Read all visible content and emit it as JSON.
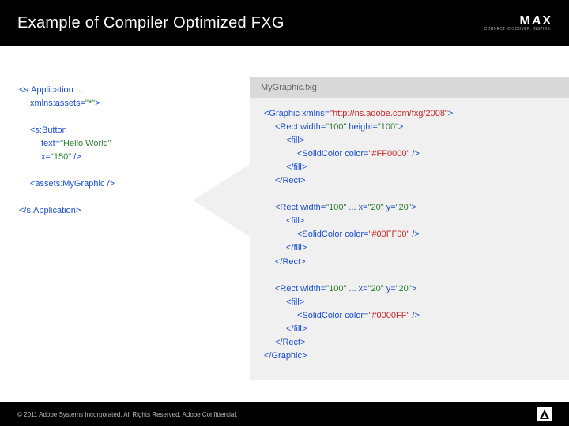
{
  "header": {
    "title": "Example of Compiler Optimized FXG",
    "logo_text": "MAX",
    "logo_tagline": "CONNECT. DISCOVER. INSPIRE."
  },
  "left": {
    "app_open": "<s:Application ...",
    "xmlns": "xmlns:assets=",
    "xmlns_val": "\"*\"",
    "xmlns_close": ">",
    "button_open": "<s:Button",
    "text_attr": "text=",
    "text_val": "\"Hello World\"",
    "x_attr": "x=",
    "x_val": "\"150\"",
    "button_close": " />",
    "mygraphic": "<assets:MyGraphic />",
    "app_close": "</s:Application>"
  },
  "right": {
    "filename": "MyGraphic.fxg:",
    "graphic_open": "<Graphic xmlns=",
    "graphic_ns": "\"http://ns.adobe.com/fxg/2008\"",
    "graphic_close": ">",
    "rect1_open": "<Rect width=",
    "rect1_w": "\"100\"",
    "rect1_mid": " height=",
    "rect1_h": "\"100\"",
    "rect1_end": ">",
    "fill_open": "<fill>",
    "solid_open": "<SolidColor color=",
    "color1": "\"#FF0000\"",
    "solid_close": " />",
    "fill_close": "</fill>",
    "rect_close": "</Rect>",
    "rect2_open": "<Rect width=",
    "rect2_w": "\"100\"",
    "rect2_mid": " ... x=",
    "rect2_x": "\"20\"",
    "rect2_mid2": " y=",
    "rect2_y": "\"20\"",
    "rect2_end": ">",
    "color2": "\"#00FF00\"",
    "color3": "\"#0000FF\"",
    "graphic_end": "</Graphic>"
  },
  "footer": {
    "copyright": "© 2011 Adobe Systems Incorporated. All Rights Reserved. Adobe Confidential."
  }
}
